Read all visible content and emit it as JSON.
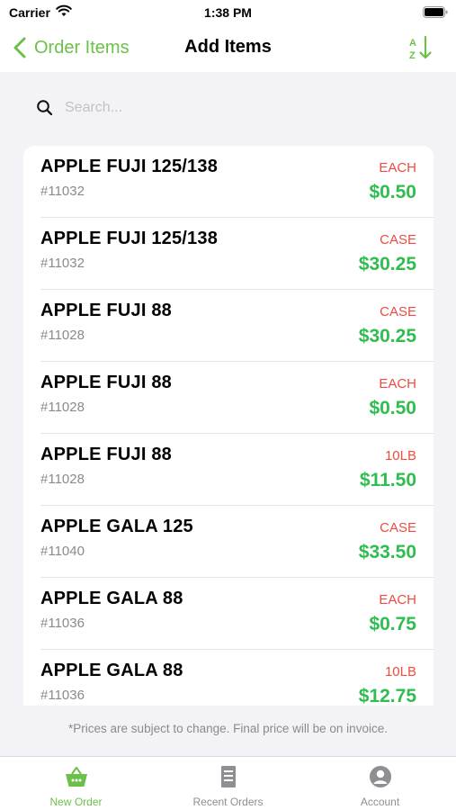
{
  "status_bar": {
    "carrier": "Carrier",
    "time": "1:38 PM"
  },
  "nav": {
    "back_label": "Order Items",
    "title": "Add Items",
    "sort_icon": "sort-az-icon"
  },
  "search": {
    "placeholder": "Search..."
  },
  "items": [
    {
      "name": "APPLE FUJI 125/138",
      "sku": "#11032",
      "unit": "EACH",
      "price": "$0.50"
    },
    {
      "name": "APPLE FUJI 125/138",
      "sku": "#11032",
      "unit": "CASE",
      "price": "$30.25"
    },
    {
      "name": "APPLE FUJI 88",
      "sku": "#11028",
      "unit": "CASE",
      "price": "$30.25"
    },
    {
      "name": "APPLE FUJI 88",
      "sku": "#11028",
      "unit": "EACH",
      "price": "$0.50"
    },
    {
      "name": "APPLE FUJI 88",
      "sku": "#11028",
      "unit": "10LB",
      "price": "$11.50"
    },
    {
      "name": "APPLE GALA 125",
      "sku": "#11040",
      "unit": "CASE",
      "price": "$33.50"
    },
    {
      "name": "APPLE GALA 88",
      "sku": "#11036",
      "unit": "EACH",
      "price": "$0.75"
    },
    {
      "name": "APPLE GALA 88",
      "sku": "#11036",
      "unit": "10LB",
      "price": "$12.75"
    }
  ],
  "disclaimer": "*Prices are subject to change. Final price will be on invoice.",
  "tabs": [
    {
      "label": "New Order",
      "icon": "basket-icon",
      "active": true
    },
    {
      "label": "Recent Orders",
      "icon": "receipt-icon",
      "active": false
    },
    {
      "label": "Account",
      "icon": "account-icon",
      "active": false
    }
  ],
  "colors": {
    "accent": "#6cc04a",
    "unit": "#ef4b3f",
    "price": "#2fbd4f",
    "background": "#f2f2f7"
  }
}
